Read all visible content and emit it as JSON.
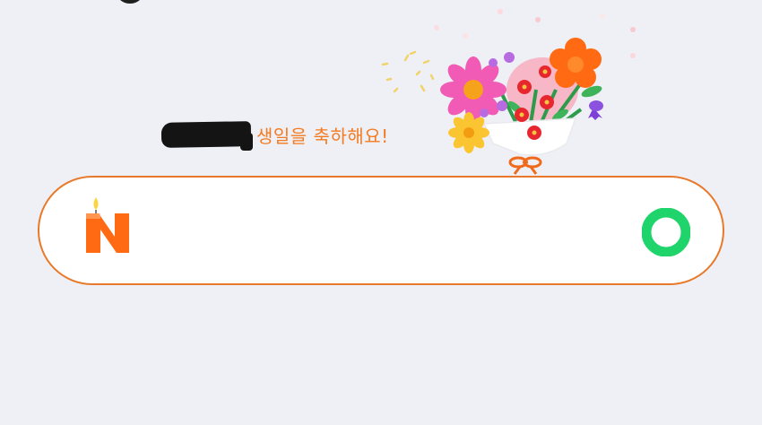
{
  "greeting": {
    "text": "생일을 축하해요!",
    "name_redacted": true
  },
  "search": {
    "value": "",
    "placeholder": ""
  },
  "logo": {
    "letter": "N",
    "icon": "birthday-candle-n-logo"
  },
  "search_button": {
    "icon": "green-ring-icon"
  },
  "colors": {
    "background": "#eef0f6",
    "accent_orange": "#f37a20",
    "border_orange": "#e8792a",
    "green": "#1fd46a"
  }
}
